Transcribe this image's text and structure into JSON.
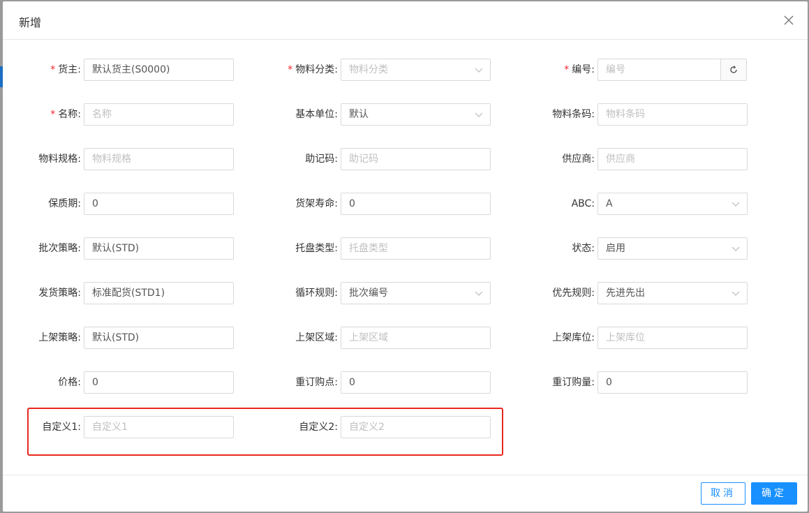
{
  "dialog": {
    "title": "新增"
  },
  "fields": {
    "owner": {
      "label": "货主:",
      "value": "默认货主(S0000)",
      "placeholder": ""
    },
    "category": {
      "label": "物料分类:",
      "value": "",
      "placeholder": "物料分类"
    },
    "code": {
      "label": "编号:",
      "value": "",
      "placeholder": "编号"
    },
    "name": {
      "label": "名称:",
      "value": "",
      "placeholder": "名称"
    },
    "base_unit": {
      "label": "基本单位:",
      "value": "默认",
      "placeholder": ""
    },
    "barcode": {
      "label": "物料条码:",
      "value": "",
      "placeholder": "物料条码"
    },
    "spec": {
      "label": "物料规格:",
      "value": "",
      "placeholder": "物料规格"
    },
    "mnemonic": {
      "label": "助记码:",
      "value": "",
      "placeholder": "助记码"
    },
    "supplier": {
      "label": "供应商:",
      "value": "",
      "placeholder": "供应商"
    },
    "shelf_life": {
      "label": "保质期:",
      "value": "0",
      "placeholder": ""
    },
    "rack_life": {
      "label": "货架寿命:",
      "value": "0",
      "placeholder": ""
    },
    "abc": {
      "label": "ABC:",
      "value": "A",
      "placeholder": ""
    },
    "batch_strategy": {
      "label": "批次策略:",
      "value": "默认(STD)",
      "placeholder": ""
    },
    "pallet_type": {
      "label": "托盘类型:",
      "value": "",
      "placeholder": "托盘类型"
    },
    "status": {
      "label": "状态:",
      "value": "启用",
      "placeholder": ""
    },
    "ship_strategy": {
      "label": "发货策略:",
      "value": "标准配货(STD1)",
      "placeholder": ""
    },
    "cycle_rule": {
      "label": "循环规则:",
      "value": "批次编号",
      "placeholder": ""
    },
    "priority_rule": {
      "label": "优先规则:",
      "value": "先进先出",
      "placeholder": ""
    },
    "putaway_strategy": {
      "label": "上架策略:",
      "value": "默认(STD)",
      "placeholder": ""
    },
    "putaway_area": {
      "label": "上架区域:",
      "value": "",
      "placeholder": "上架区域"
    },
    "putaway_location": {
      "label": "上架库位:",
      "value": "",
      "placeholder": "上架库位"
    },
    "price": {
      "label": "价格:",
      "value": "0",
      "placeholder": ""
    },
    "reorder_point": {
      "label": "重订购点:",
      "value": "0",
      "placeholder": ""
    },
    "reorder_qty": {
      "label": "重订购量:",
      "value": "0",
      "placeholder": ""
    },
    "custom1": {
      "label": "自定义1:",
      "value": "",
      "placeholder": "自定义1"
    },
    "custom2": {
      "label": "自定义2:",
      "value": "",
      "placeholder": "自定义2"
    }
  },
  "required_mark": "*",
  "footer": {
    "cancel_label": "取消",
    "ok_label": "确定"
  },
  "icons": {
    "close": "close-icon",
    "dropdown": "chevron-down-icon",
    "refresh": "refresh-icon"
  },
  "colors": {
    "primary": "#1890ff",
    "required": "#f5222d",
    "highlight": "#e8281f"
  }
}
